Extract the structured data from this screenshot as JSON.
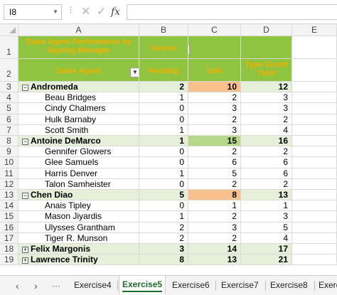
{
  "formula_bar": {
    "name_box": "I8",
    "cancel_icon": "✕",
    "enter_icon": "✓",
    "fx_label": "fx",
    "formula": ""
  },
  "columns": [
    "A",
    "B",
    "C",
    "D",
    "E"
  ],
  "header": {
    "title_line1": "Sales Agent Performance by",
    "title_line2": "Signing Manager",
    "source_label": "Source",
    "row_label": "Sales Agent",
    "pending": "Pending",
    "sale": "Sale",
    "grand_line1": "Type Grand",
    "grand_line2": "Total"
  },
  "rows": [
    {
      "num": "3",
      "label": "Andromeda",
      "group": true,
      "expanded": true,
      "b": "2",
      "c": "10",
      "d": "12",
      "c_highlight": "orange"
    },
    {
      "num": "4",
      "label": "Beau Bridges",
      "b": "1",
      "c": "2",
      "d": "3"
    },
    {
      "num": "5",
      "label": "Cindy Chalmers",
      "b": "0",
      "c": "3",
      "d": "3"
    },
    {
      "num": "6",
      "label": "Hulk Barnaby",
      "b": "0",
      "c": "2",
      "d": "2"
    },
    {
      "num": "7",
      "label": "Scott Smith",
      "b": "1",
      "c": "3",
      "d": "4"
    },
    {
      "num": "8",
      "label": "Antoine DeMarco",
      "group": true,
      "expanded": true,
      "b": "1",
      "c": "15",
      "d": "16",
      "c_highlight": "green"
    },
    {
      "num": "9",
      "label": "Gennifer Glowers",
      "b": "0",
      "c": "2",
      "d": "2"
    },
    {
      "num": "10",
      "label": "Glee Samuels",
      "b": "0",
      "c": "6",
      "d": "6"
    },
    {
      "num": "11",
      "label": "Harris Denver",
      "b": "1",
      "c": "5",
      "d": "6"
    },
    {
      "num": "12",
      "label": "Talon Samheister",
      "b": "0",
      "c": "2",
      "d": "2"
    },
    {
      "num": "13",
      "label": "Chen Diao",
      "group": true,
      "expanded": true,
      "b": "5",
      "c": "8",
      "d": "13",
      "c_highlight": "orange"
    },
    {
      "num": "14",
      "label": "Anais Tipley",
      "b": "0",
      "c": "1",
      "d": "1"
    },
    {
      "num": "15",
      "label": "Mason Jiyardis",
      "b": "1",
      "c": "2",
      "d": "3"
    },
    {
      "num": "16",
      "label": "Ulysses Grantham",
      "b": "2",
      "c": "3",
      "d": "5"
    },
    {
      "num": "17",
      "label": "Tiger R. Munson",
      "b": "2",
      "c": "2",
      "d": "4"
    },
    {
      "num": "18",
      "label": "Felix Margonis",
      "group": true,
      "expanded": false,
      "b": "3",
      "c": "14",
      "d": "17"
    },
    {
      "num": "19",
      "label": "Lawrence Trinity",
      "group": true,
      "expanded": false,
      "b": "8",
      "c": "13",
      "d": "21"
    }
  ],
  "tabs": {
    "nav_prev": "‹",
    "nav_next": "›",
    "more": "···",
    "items": [
      "Exercise4",
      "Exercise5",
      "Exercise6",
      "Exercise7",
      "Exercise8",
      "Exercise"
    ],
    "active": "Exercise5"
  },
  "colors": {
    "header_green": "#8fc440",
    "header_text": "#f5b000",
    "group_row": "#e6efd9",
    "highlight_orange": "#f8c08d",
    "highlight_green": "#b5d88a"
  }
}
